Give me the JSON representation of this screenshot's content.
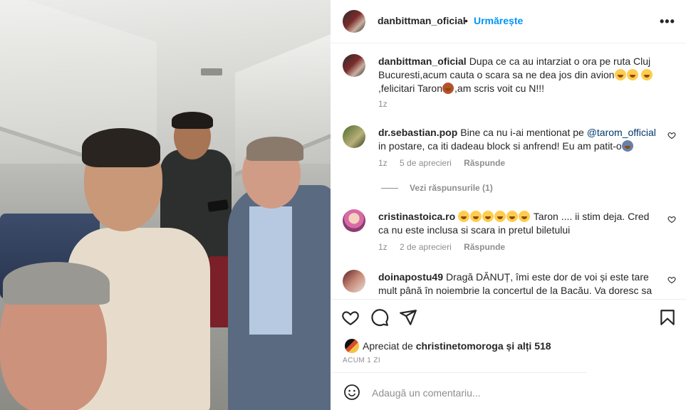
{
  "post": {
    "author": "danbittman_oficial",
    "follow_label": "Urmărește",
    "separator": "•",
    "more_label": "•••"
  },
  "caption": {
    "username": "danbittman_oficial",
    "text_1": "Dupa ce ca au intarziat o ora pe ruta Cluj Bucuresti,acum cauta o scara sa ne dea jos din avion",
    "text_2": ",felicitari Taron",
    "text_3": ",am scris voit cu N!!!",
    "time": "1z"
  },
  "comments": [
    {
      "username": "dr.sebastian.pop",
      "text_1": "Bine ca nu i-ai mentionat pe",
      "mention": "@tarom_official",
      "text_2": "in postare, ca iti dadeau block si anfrend! Eu am patit-o",
      "time": "1z",
      "likes": "5 de aprecieri",
      "reply": "Răspunde",
      "view_replies": "Vezi răspunsurile (1)"
    },
    {
      "username": "cristinastoica.ro",
      "text_1": "Taron .... ii stim deja. Cred ca nu este inclusa si scara in pretul biletului",
      "time": "1z",
      "likes": "2 de aprecieri",
      "reply": "Răspunde"
    },
    {
      "username": "doinapostu49",
      "text_1": "Dragă DĂNUȚ, îmi este dor de voi și este tare mult până în noiembrie la concertul de la Bacău. Va doresc sa"
    }
  ],
  "likes": {
    "prefix": "Apreciat de",
    "user": "christinetomoroga",
    "suffix": "și alți 518"
  },
  "time_ago": "ACUM 1 ZI",
  "add_comment": {
    "placeholder": "Adaugă un comentariu..."
  },
  "icons": {
    "like": "heart-icon",
    "comment": "comment-icon",
    "share": "share-icon",
    "save": "bookmark-icon",
    "emoji": "smile-icon"
  }
}
